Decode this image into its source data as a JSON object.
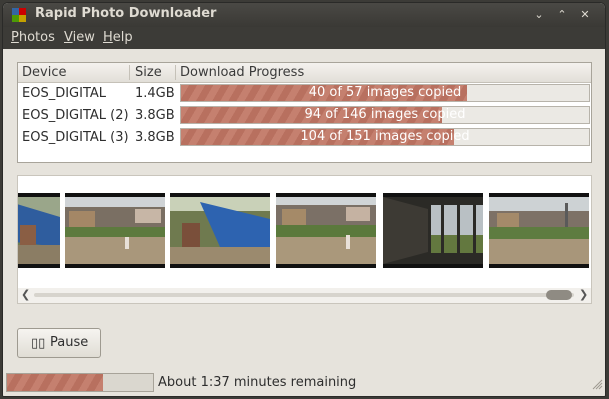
{
  "window": {
    "title": "Rapid Photo Downloader",
    "controls": [
      "minimize-icon",
      "maximize-icon",
      "close-icon"
    ]
  },
  "menu": {
    "items": [
      {
        "label": "Photos",
        "mnemonic": "P"
      },
      {
        "label": "View",
        "mnemonic": "V"
      },
      {
        "label": "Help",
        "mnemonic": "H"
      }
    ]
  },
  "devices": {
    "columns": [
      "Device",
      "Size",
      "Download Progress"
    ],
    "rows": [
      {
        "device": "EOS_DIGITAL",
        "size": "1.4GB",
        "progress_text": "40 of 57 images copied",
        "progress": 0.7
      },
      {
        "device": "EOS_DIGITAL (2)",
        "size": "3.8GB",
        "progress_text": "94 of 146 images copied",
        "progress": 0.64
      },
      {
        "device": "EOS_DIGITAL (3)",
        "size": "3.8GB",
        "progress_text": "104 of 151 images copied",
        "progress": 0.67
      }
    ]
  },
  "thumbnails": {
    "count": 6,
    "items": [
      "photo-thumbnail",
      "photo-thumbnail",
      "photo-thumbnail",
      "photo-thumbnail",
      "photo-thumbnail",
      "photo-thumbnail"
    ]
  },
  "actions": {
    "pause_label": "Pause",
    "pause_icon": "pause-icon"
  },
  "status": {
    "progress": 0.66,
    "text": "About 1:37 minutes remaining"
  },
  "colors": {
    "progress_fill": "#c5806f",
    "titlebar": "#3c3b37",
    "window_bg": "#e6e3dc"
  }
}
